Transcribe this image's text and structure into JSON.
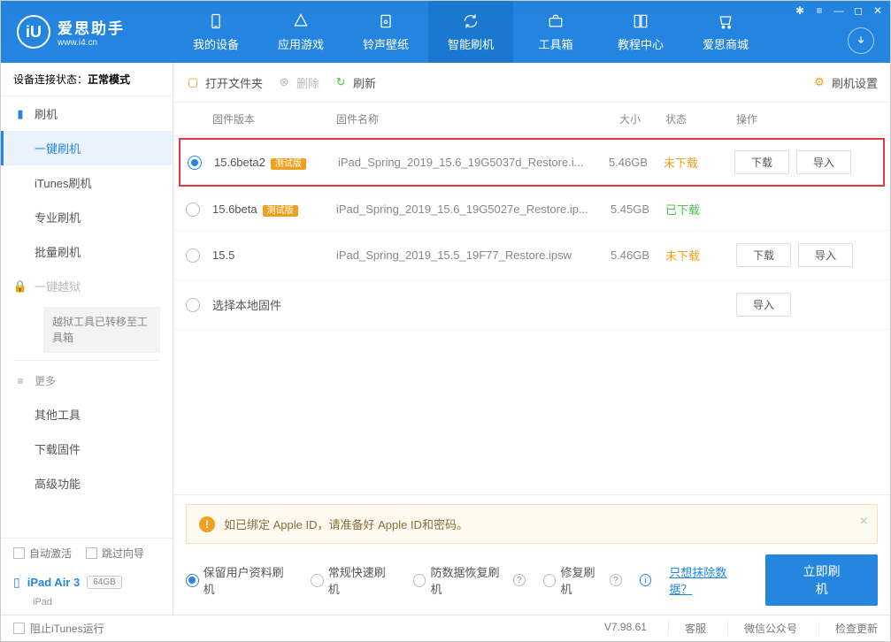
{
  "app": {
    "title": "爱思助手",
    "url": "www.i4.cn"
  },
  "nav": [
    {
      "label": "我的设备"
    },
    {
      "label": "应用游戏"
    },
    {
      "label": "铃声壁纸"
    },
    {
      "label": "智能刷机",
      "active": true
    },
    {
      "label": "工具箱"
    },
    {
      "label": "教程中心"
    },
    {
      "label": "爱思商城"
    }
  ],
  "status": {
    "label": "设备连接状态：",
    "value": "正常模式"
  },
  "sidebar": {
    "group1": {
      "label": "刷机"
    },
    "items1": [
      {
        "label": "一键刷机",
        "active": true
      },
      {
        "label": "iTunes刷机"
      },
      {
        "label": "专业刷机"
      },
      {
        "label": "批量刷机"
      }
    ],
    "jailbreak": {
      "label": "一键越狱"
    },
    "jailbreak_note": "越狱工具已转移至工具箱",
    "more": {
      "label": "更多"
    },
    "items_more": [
      {
        "label": "其他工具"
      },
      {
        "label": "下载固件"
      },
      {
        "label": "高级功能"
      }
    ],
    "auto_activate": "自动激活",
    "skip_guide": "跳过向导"
  },
  "device": {
    "name": "iPad Air 3",
    "storage": "64GB",
    "type": "iPad"
  },
  "toolbar": {
    "open": "打开文件夹",
    "delete": "删除",
    "refresh": "刷新",
    "settings": "刷机设置"
  },
  "columns": {
    "version": "固件版本",
    "name": "固件名称",
    "size": "大小",
    "status": "状态",
    "ops": "操作"
  },
  "rows": [
    {
      "selected": true,
      "highlight": true,
      "version": "15.6beta2",
      "beta": "测试版",
      "filename": "iPad_Spring_2019_15.6_19G5037d_Restore.i...",
      "size": "5.46GB",
      "status": "未下载",
      "status_class": "nd",
      "btns": [
        "下载",
        "导入"
      ]
    },
    {
      "selected": false,
      "version": "15.6beta",
      "beta": "测试版",
      "filename": "iPad_Spring_2019_15.6_19G5027e_Restore.ip...",
      "size": "5.45GB",
      "status": "已下载",
      "status_class": "dl",
      "btns": []
    },
    {
      "selected": false,
      "version": "15.5",
      "beta": "",
      "filename": "iPad_Spring_2019_15.5_19F77_Restore.ipsw",
      "size": "5.46GB",
      "status": "未下载",
      "status_class": "nd",
      "btns": [
        "下载",
        "导入"
      ]
    },
    {
      "selected": false,
      "version": "选择本地固件",
      "beta": "",
      "filename": "",
      "size": "",
      "status": "",
      "status_class": "",
      "btns": [
        "导入"
      ]
    }
  ],
  "notice": "如已绑定 Apple ID，请准备好 Apple ID和密码。",
  "flash_options": [
    {
      "label": "保留用户资料刷机",
      "selected": true,
      "help": false
    },
    {
      "label": "常规快速刷机",
      "selected": false,
      "help": false
    },
    {
      "label": "防数据恢复刷机",
      "selected": false,
      "help": true
    },
    {
      "label": "修复刷机",
      "selected": false,
      "help": true
    }
  ],
  "erase_link": "只想抹除数据？",
  "flash_btn": "立即刷机",
  "footer": {
    "block_itunes": "阻止iTunes运行",
    "version": "V7.98.61",
    "links": [
      "客服",
      "微信公众号",
      "检查更新"
    ]
  }
}
